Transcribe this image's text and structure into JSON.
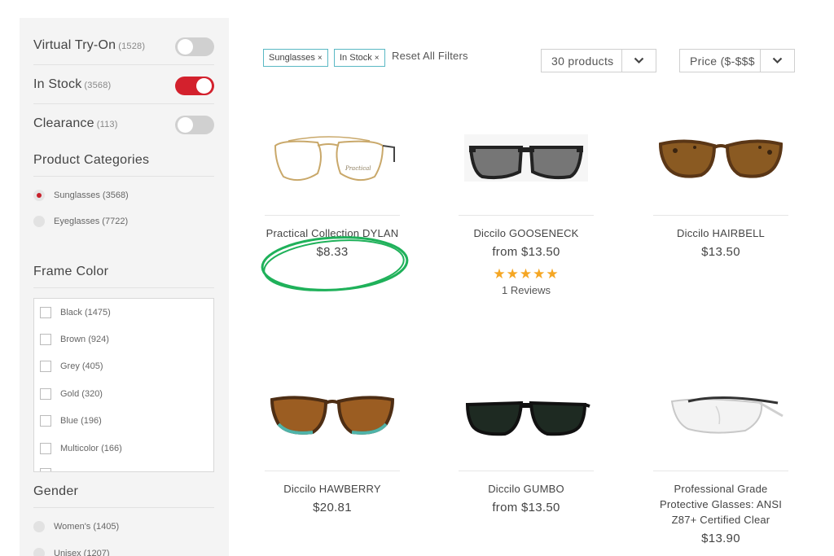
{
  "sidebar": {
    "toggles": [
      {
        "label": "Virtual Try-On",
        "count": "(1528)",
        "on": false
      },
      {
        "label": "In Stock",
        "count": "(3568)",
        "on": true
      },
      {
        "label": "Clearance",
        "count": "(113)",
        "on": false
      }
    ],
    "product_categories": {
      "title": "Product Categories",
      "items": [
        {
          "label": "Sunglasses (3568)",
          "checked": true
        },
        {
          "label": "Eyeglasses (7722)",
          "checked": false
        }
      ]
    },
    "frame_color": {
      "title": "Frame Color",
      "items": [
        {
          "label": "Black (1475)"
        },
        {
          "label": "Brown (924)"
        },
        {
          "label": "Grey (405)"
        },
        {
          "label": "Gold (320)"
        },
        {
          "label": "Blue (196)"
        },
        {
          "label": "Multicolor (166)"
        }
      ]
    },
    "gender": {
      "title": "Gender",
      "items": [
        {
          "label": "Women's (1405)"
        },
        {
          "label": "Unisex (1207)"
        }
      ]
    }
  },
  "filters": {
    "chips": [
      "Sunglasses",
      "In Stock"
    ],
    "chip_remove": "×",
    "reset_label": "Reset All Filters",
    "count_select": "30 products",
    "sort_select": "Price ($-$$$"
  },
  "products": [
    {
      "name": "Practical Collection DYLAN",
      "price": "$8.33",
      "image": "gold-aviator-eyeglasses"
    },
    {
      "name": "Diccilo GOOSENECK",
      "price": "from $13.50",
      "image": "black-rectangle-sunglasses",
      "rating": "★★★★★",
      "reviews": "1 Reviews"
    },
    {
      "name": "Diccilo HAIRBELL",
      "price": "$13.50",
      "image": "tortoise-cateye-sunglasses"
    },
    {
      "name": "Diccilo HAWBERRY",
      "price": "$20.81",
      "image": "tortoise-teal-sunglasses"
    },
    {
      "name": "Diccilo GUMBO",
      "price": "from $13.50",
      "image": "black-wayfarer-sunglasses"
    },
    {
      "name": "Professional Grade Protective Glasses: ANSI Z87+ Certified Clear",
      "price": "$13.90",
      "image": "clear-safety-glasses"
    }
  ],
  "colors": {
    "accent_red": "#d3212d",
    "chip_border": "#59b8c4",
    "star": "#f5a623",
    "highlight_green": "#1fb15a"
  }
}
